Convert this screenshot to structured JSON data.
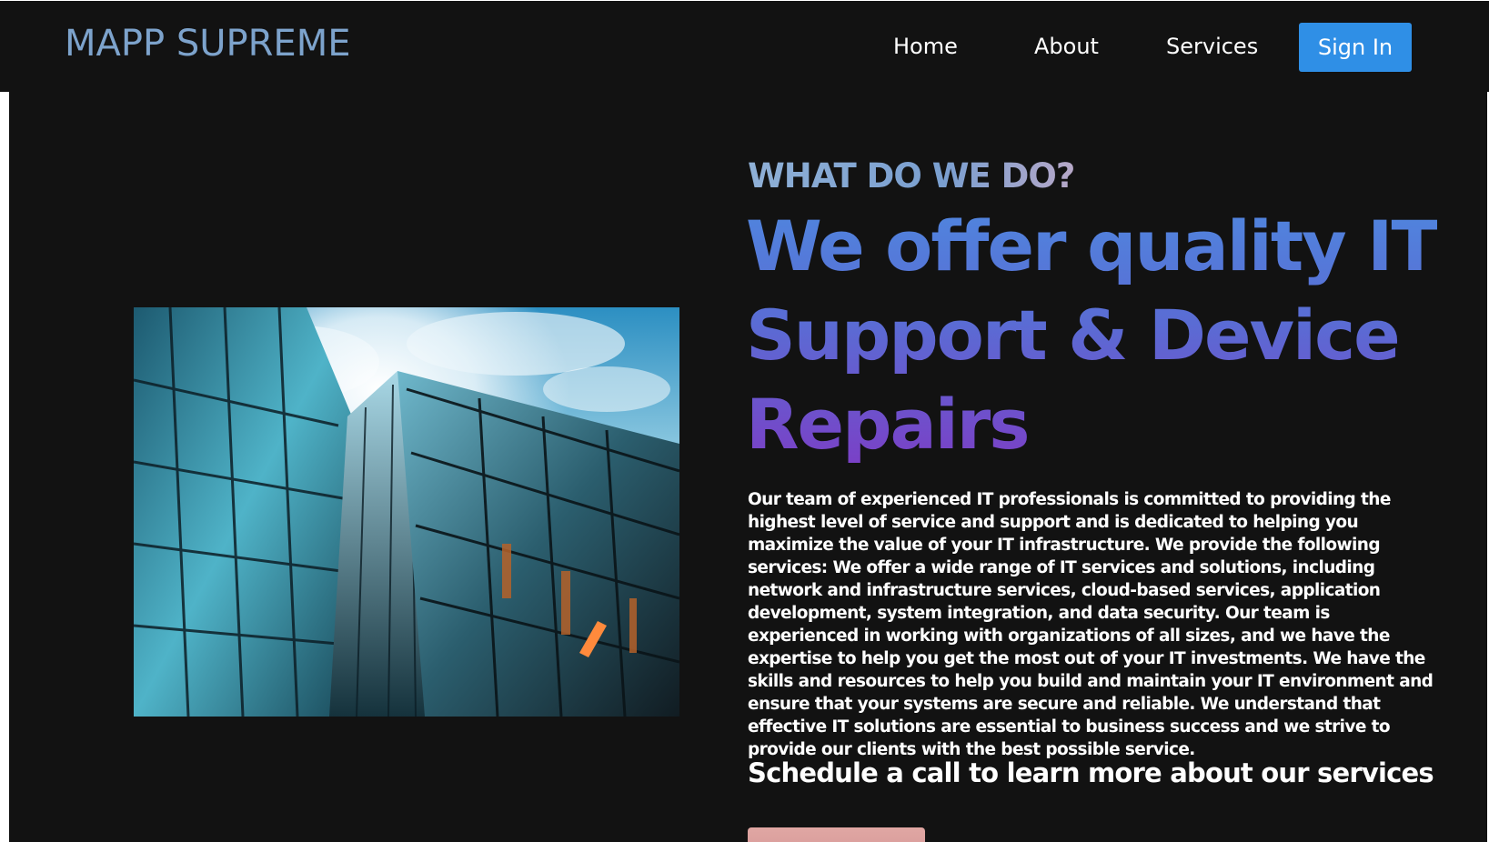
{
  "header": {
    "brand": "MAPP SUPREME",
    "nav": {
      "home": "Home",
      "about": "About",
      "services": "Services"
    },
    "signin_label": "Sign In"
  },
  "hero": {
    "eyebrow": "WHAT DO WE DO?",
    "headline": "We offer quality IT Support & Device Repairs",
    "body": "Our team of experienced IT professionals is committed to providing the highest level of service and support and is dedicated to helping you maximize the value of your IT infrastructure. We provide the following services: We offer a wide range of IT services and solutions, including network and infrastructure services, cloud-based services, application development, system integration, and data security. Our team is experienced in working with organizations of all sizes, and we have the expertise to help you get the most out of your IT investments. We have the skills and resources to help you build and maintain your IT environment and ensure that your systems are secure and reliable. We understand that effective IT solutions are essential to business success and we strive to provide our clients with the best possible service.",
    "cta_heading": "Schedule a call to learn more about our services"
  },
  "colors": {
    "background": "#121212",
    "brand": "#7da3cc",
    "accent_button": "#2f8fe6",
    "headline_top": "#4f86de",
    "headline_bottom": "#7b3fc6",
    "cta_button": "#e0a7a3"
  },
  "images": {
    "hero_photo": "glass-skyscrapers-photo"
  }
}
